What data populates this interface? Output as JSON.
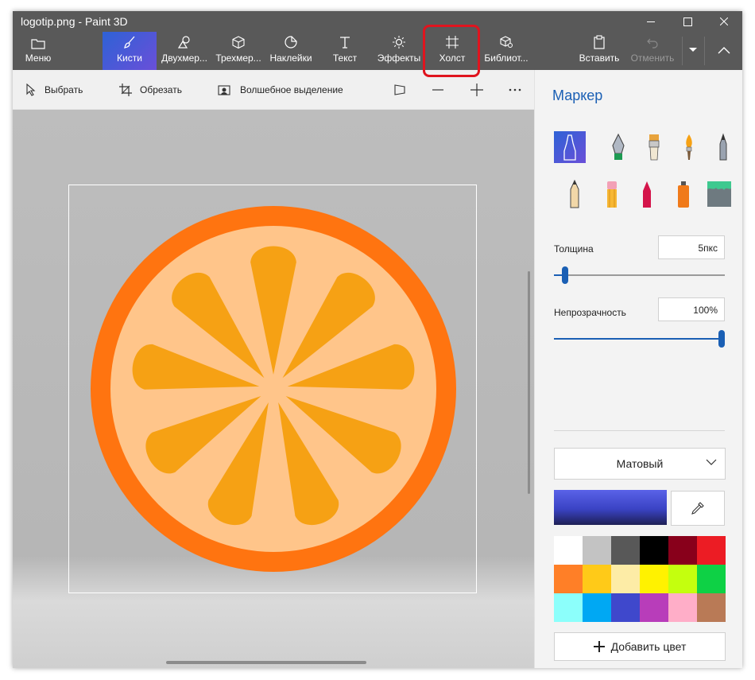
{
  "window": {
    "title": "logotip.png - Paint 3D"
  },
  "ribbon": {
    "menu": "Меню",
    "brushes": "Кисти",
    "shapes2d": "Двухмер...",
    "shapes3d": "Трехмер...",
    "stickers": "Наклейки",
    "text": "Текст",
    "effects": "Эффекты",
    "canvas": "Холст",
    "library": "Библиот...",
    "paste": "Вставить",
    "undo": "Отменить"
  },
  "toolbar": {
    "select": "Выбрать",
    "crop": "Обрезать",
    "magic_select": "Волшебное выделение"
  },
  "panel": {
    "title": "Маркер",
    "thickness_label": "Толщина",
    "thickness_value": "5пкс",
    "opacity_label": "Непрозрачность",
    "opacity_value": "100%",
    "thickness_level": 0.05,
    "opacity_level": 1.0,
    "finish": "Матовый",
    "add_color": "Добавить цвет",
    "current_color": "#3a43c4",
    "palette": [
      "#ffffff",
      "#c3c3c3",
      "#585858",
      "#000000",
      "#88001b",
      "#ec1c24",
      "#ff7f27",
      "#ffca18",
      "#fdeca6",
      "#fff200",
      "#c4ff0e",
      "#0ed145",
      "#8cfffb",
      "#00a8f3",
      "#3f48cc",
      "#b83dba",
      "#ffaec8",
      "#b97a56"
    ]
  },
  "artwork": {
    "outer_color": "#ff7410",
    "inner_color": "#ffc58a",
    "segment_color": "#f6a114"
  }
}
